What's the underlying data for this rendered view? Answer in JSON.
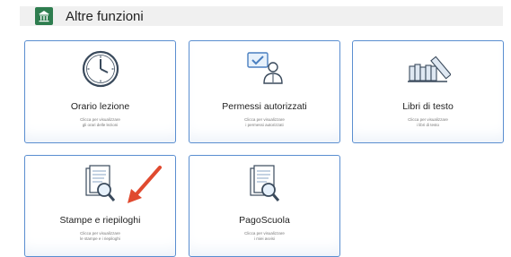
{
  "header": {
    "title": "Altre funzioni",
    "icon": "school-building-icon",
    "icon_color": "#2e7d4f"
  },
  "cards": [
    {
      "title": "Orario lezione",
      "subtitle_line1": "Clicca per visualizzare",
      "subtitle_line2": "gli orari delle lezioni",
      "icon": "clock-icon"
    },
    {
      "title": "Permessi autorizzati",
      "subtitle_line1": "Clicca per visualizzare",
      "subtitle_line2": "i permessi autorizzati",
      "icon": "approved-user-icon"
    },
    {
      "title": "Libri di testo",
      "subtitle_line1": "Clicca per visualizzare",
      "subtitle_line2": "i libri di testo",
      "icon": "books-icon"
    },
    {
      "title": "Stampe e riepiloghi",
      "subtitle_line1": "Clicca per visualizzare",
      "subtitle_line2": "le stampe e i riepiloghi",
      "icon": "document-search-icon"
    },
    {
      "title": "PagoScuola",
      "subtitle_line1": "Clicca per visualizzare",
      "subtitle_line2": "i miei avvisi",
      "icon": "document-search-icon"
    }
  ],
  "colors": {
    "card_border": "#5a8ed0",
    "accent_arrow": "#e04a2f",
    "header_bg": "#f0f0f0"
  }
}
